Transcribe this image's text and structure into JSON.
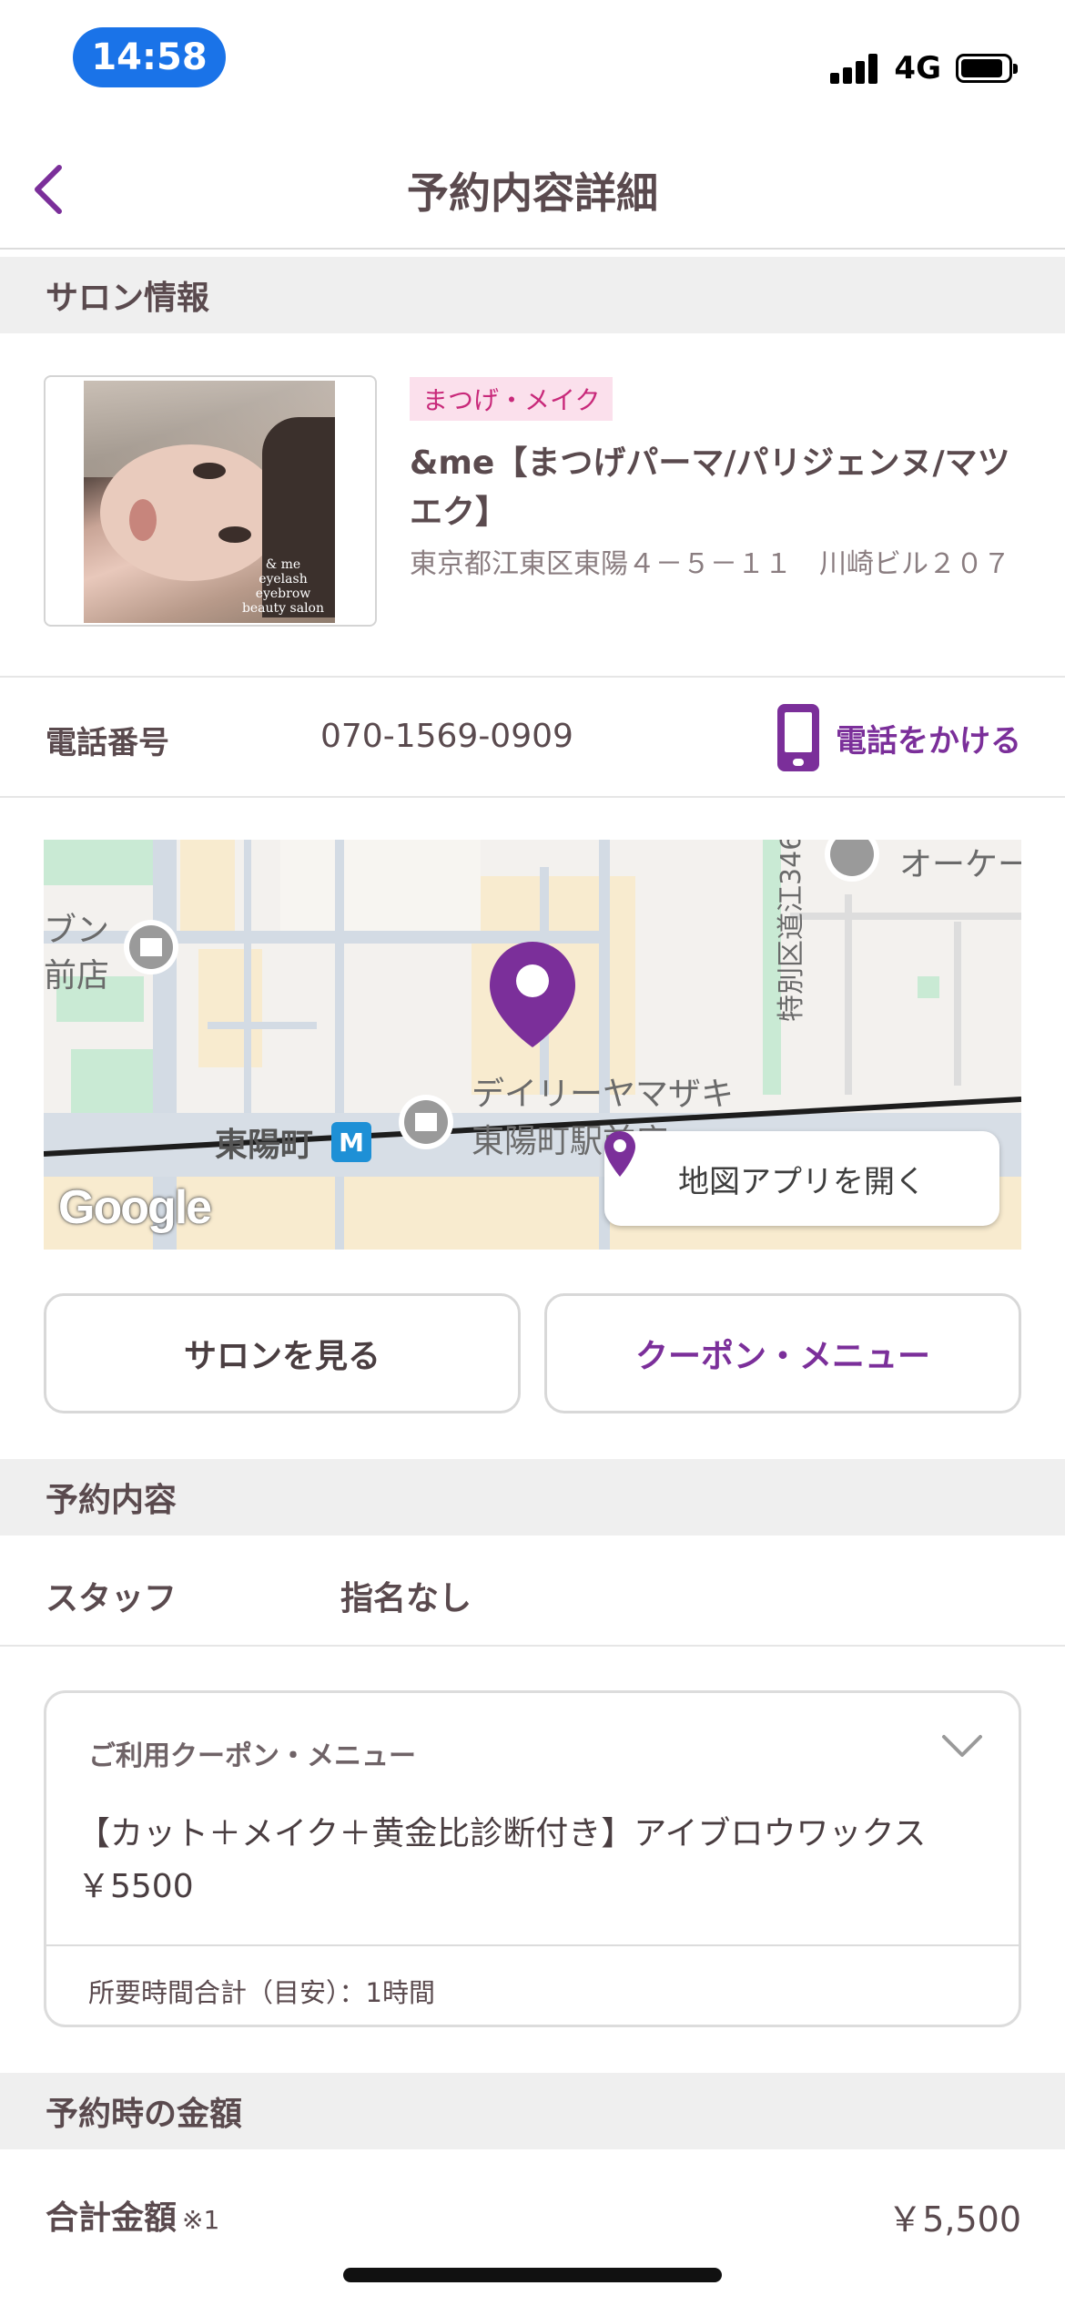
{
  "status_bar": {
    "time": "14:58",
    "network": "4G",
    "icons": [
      "signal-icon",
      "battery-icon"
    ]
  },
  "nav": {
    "title": "予約内容詳細",
    "back_icon": "chevron-left-icon"
  },
  "salon_section": {
    "header": "サロン情報",
    "category": "まつげ・メイク",
    "name": "&me【まつげパーマ/パリジェンヌ/マツエク】",
    "address": "東京都江東区東陽４－５－１１　川崎ビル２０７",
    "photo_logo_text": "&me eyelash eyebrow beauty salon"
  },
  "phone": {
    "label": "電話番号",
    "number": "070-1569-0909",
    "call_label": "電話をかける"
  },
  "map": {
    "labels": {
      "okay": "オーケー",
      "seven_top": "ブン",
      "seven_bottom": "前店",
      "road": "特別区道江346",
      "station": "東陽町",
      "daily_1": "デイリーヤマザキ",
      "daily_2": "東陽町駅前店"
    },
    "google": "Google",
    "open_app_label": "地図アプリを開く",
    "accent_color": "#7b2f9a"
  },
  "actions": {
    "view_salon": "サロンを見る",
    "coupon_menu": "クーポン・メニュー"
  },
  "reservation": {
    "header": "予約内容",
    "staff_label": "スタッフ",
    "staff_value": "指名なし",
    "coupon_header": "ご利用クーポン・メニュー",
    "coupon_menu_line1": "【カット＋メイク＋黄金比診断付き】アイブロウワックス",
    "coupon_menu_line2": "￥5500",
    "duration": "所要時間合計（目安）：1時間"
  },
  "amount": {
    "header": "予約時の金額",
    "total_label": "合計金額",
    "total_note": "※1",
    "total_value": "￥5,500"
  },
  "colors": {
    "brand_purple": "#7b2f9a",
    "badge_bg": "#fbe0ec",
    "badge_text": "#c8297a",
    "time_pill": "#1a73e8"
  }
}
